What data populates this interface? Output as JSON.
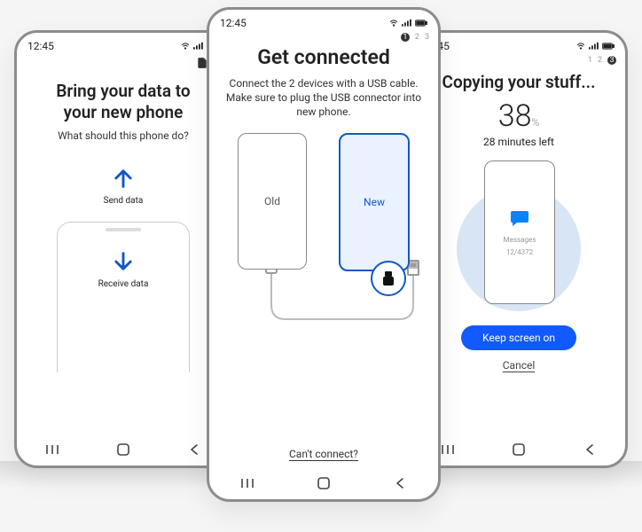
{
  "status": {
    "time": "12:45"
  },
  "left": {
    "title_line1": "Bring your data to",
    "title_line2": "your new phone",
    "subtitle": "What should this phone do?",
    "send_label": "Send data",
    "receive_label": "Receive data"
  },
  "center": {
    "step": {
      "current": "1",
      "b": "2",
      "c": "3"
    },
    "title": "Get connected",
    "subtitle": "Connect the 2 devices with a USB cable. Make sure to plug the USB connector into new phone.",
    "old_label": "Old",
    "new_label": "New",
    "cant_connect": "Can't connect?"
  },
  "right": {
    "step": {
      "a": "1",
      "b": "2",
      "current": "3"
    },
    "title": "Copying your stuff...",
    "percent_value": "38",
    "percent_unit": "%",
    "timeleft": "28 minutes left",
    "messages_label": "Messages",
    "messages_count": "12/4372",
    "keep_screen_on": "Keep screen on",
    "cancel": "Cancel"
  }
}
